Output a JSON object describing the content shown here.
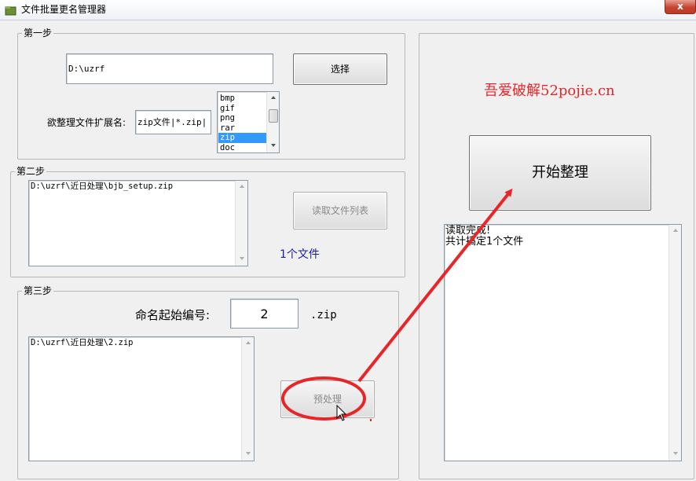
{
  "window": {
    "title": "文件批量更名管理器",
    "close_glyph": "x"
  },
  "step1": {
    "title": "第一步",
    "path_value": "D:\\uzrf",
    "select_button": "选择",
    "ext_label": "欲整理文件扩展名:",
    "ext_value": "zip文件|*.zip|",
    "ext_list": [
      "bmp",
      "gif",
      "png",
      "rar",
      "zip",
      "doc"
    ],
    "ext_selected": "zip"
  },
  "step2": {
    "title": "第二步",
    "file_list": [
      "D:\\uzrf\\近日处理\\bjb_setup.zip"
    ],
    "read_button": "读取文件列表",
    "file_count": "1个文件"
  },
  "step3": {
    "title": "第三步",
    "start_label": "命名起始编号:",
    "start_value": "2",
    "ext_suffix": ".zip",
    "preview_list": [
      "D:\\uzrf\\近日处理\\2.zip"
    ],
    "preprocess_button": "预处理"
  },
  "right": {
    "watermark": "吾爱破解52pojie.cn",
    "start_button": "开始整理",
    "log_lines": [
      "读取完成!",
      "共计搞定1个文件"
    ]
  },
  "colors": {
    "annotation": "#e8262a",
    "count_text": "#1a1aa6",
    "selection": "#3399ff"
  },
  "icons": {
    "app": "folder-icon",
    "cursor": "mouse-pointer-icon"
  }
}
